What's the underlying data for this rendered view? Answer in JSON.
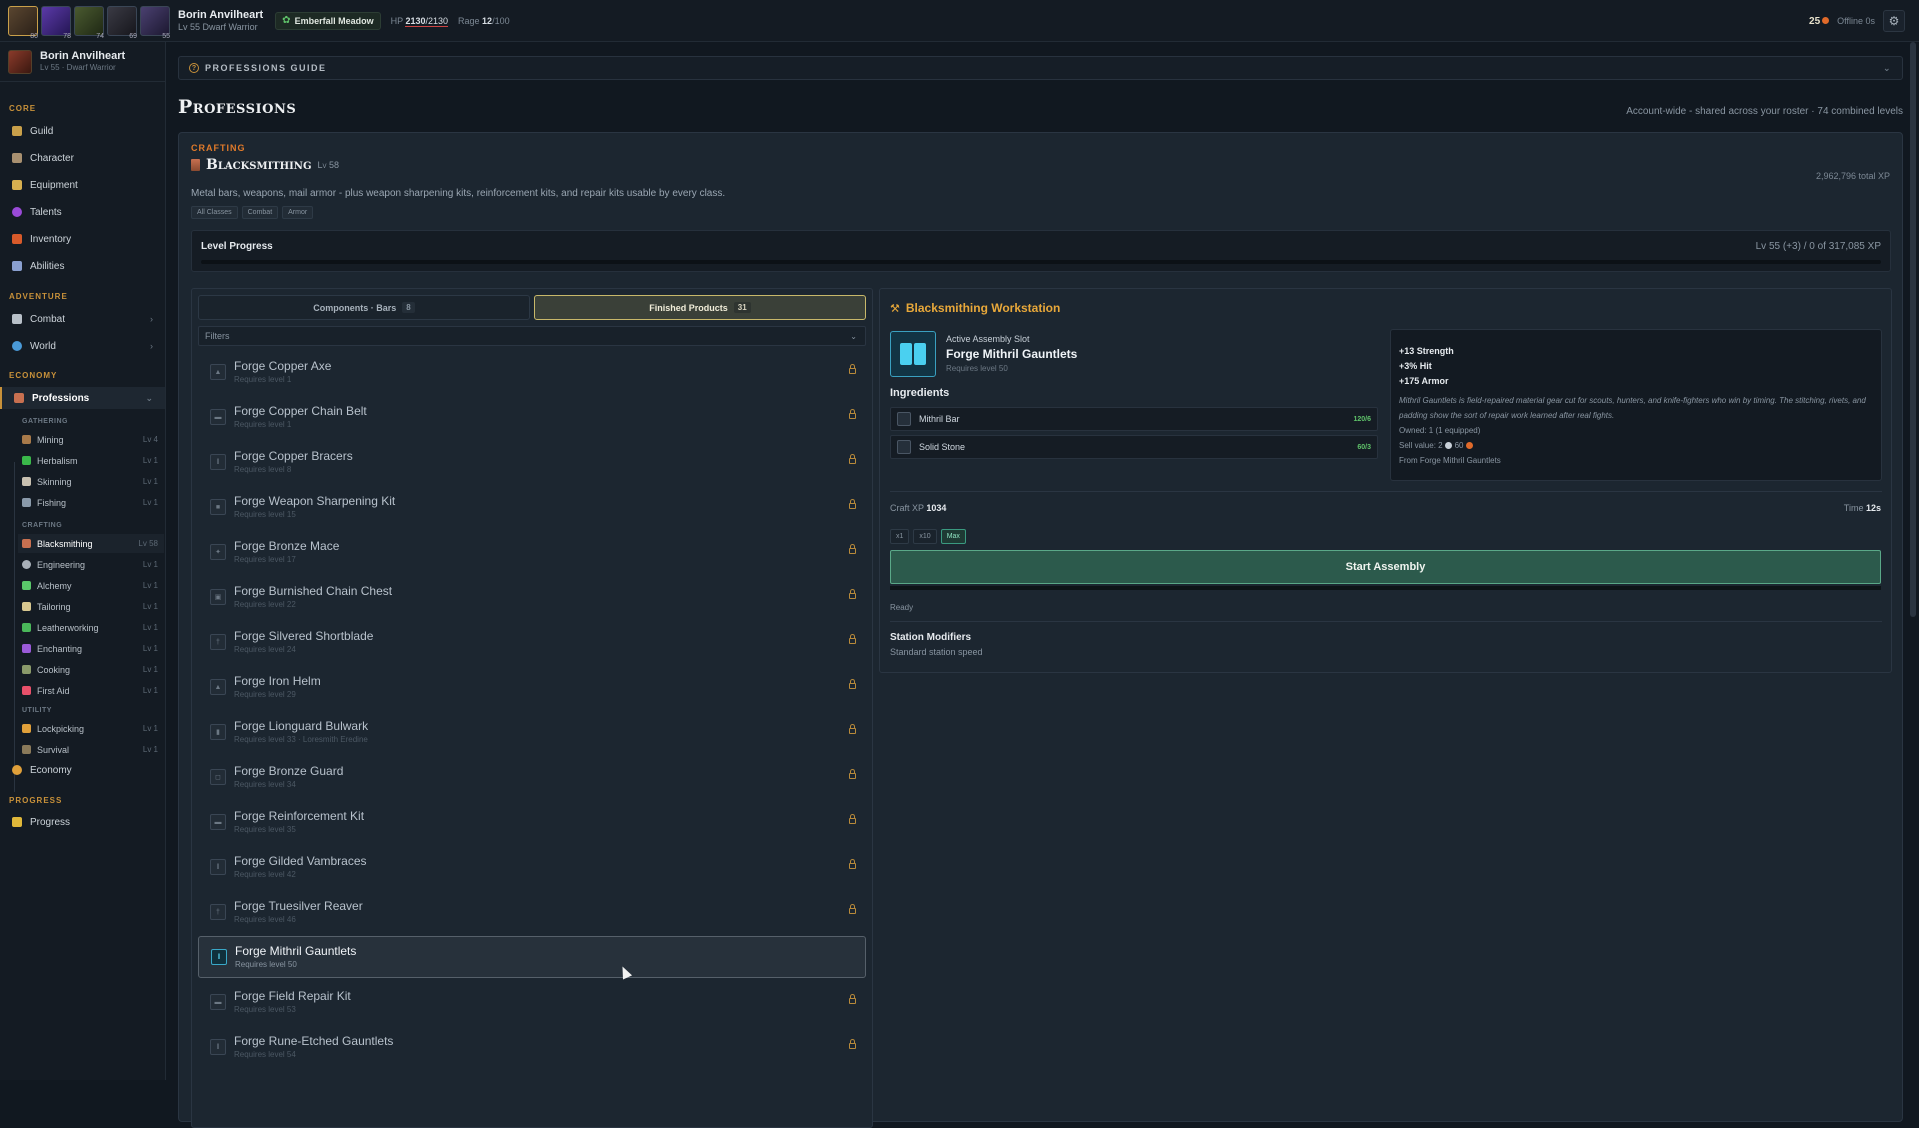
{
  "topbar": {
    "portraits": [
      {
        "name": "warrior-portrait",
        "level": "80"
      },
      {
        "name": "mage-portrait",
        "level": "78"
      },
      {
        "name": "hunter-portrait",
        "level": "74"
      },
      {
        "name": "rogue-portrait",
        "level": "69"
      },
      {
        "name": "priest-portrait",
        "level": "55"
      }
    ],
    "char_name": "Borin Anvilheart",
    "char_sub": "Lv 55 Dwarf Warrior",
    "zone": "Emberfall Meadow",
    "hp_label": "HP",
    "hp_value": "2130",
    "hp_max": "/2130",
    "rage_label": "Rage",
    "rage_value": "12",
    "rage_max": "/100",
    "gold": "25",
    "offline": "Offline 0s"
  },
  "sidebar": {
    "user_name": "Borin Anvilheart",
    "user_sub": "Lv 55 · Dwarf Warrior",
    "sections": {
      "core": "CORE",
      "adventure": "ADVENTURE",
      "economy": "ECONOMY",
      "progress": "PROGRESS"
    },
    "core": [
      "Guild",
      "Character",
      "Equipment",
      "Talents",
      "Inventory",
      "Abilities"
    ],
    "adventure": [
      "Combat",
      "World"
    ],
    "professions_label": "Professions",
    "sub_sections": {
      "gathering": "GATHERING",
      "crafting": "CRAFTING",
      "utility": "UTILITY"
    },
    "gathering": [
      {
        "label": "Mining",
        "lvl": "Lv 4"
      },
      {
        "label": "Herbalism",
        "lvl": "Lv 1"
      },
      {
        "label": "Skinning",
        "lvl": "Lv 1"
      },
      {
        "label": "Fishing",
        "lvl": "Lv 1"
      }
    ],
    "crafting": [
      {
        "label": "Blacksmithing",
        "lvl": "Lv 58"
      },
      {
        "label": "Engineering",
        "lvl": "Lv 1"
      },
      {
        "label": "Alchemy",
        "lvl": "Lv 1"
      },
      {
        "label": "Tailoring",
        "lvl": "Lv 1"
      },
      {
        "label": "Leatherworking",
        "lvl": "Lv 1"
      },
      {
        "label": "Enchanting",
        "lvl": "Lv 1"
      },
      {
        "label": "Cooking",
        "lvl": "Lv 1"
      },
      {
        "label": "First Aid",
        "lvl": "Lv 1"
      }
    ],
    "utility": [
      {
        "label": "Lockpicking",
        "lvl": "Lv 1"
      },
      {
        "label": "Survival",
        "lvl": "Lv 1"
      }
    ],
    "economy_label": "Economy",
    "progress_label": "Progress"
  },
  "main": {
    "guide": "PROFESSIONS GUIDE",
    "title": "Professions",
    "subtitle": "Account-wide - shared across your roster · 74 combined levels",
    "category": "CRAFTING",
    "prof_name": "Blacksmithing",
    "prof_lv": "Lv 58",
    "total_xp": "2,962,796 total XP",
    "desc": "Metal bars, weapons, mail armor - plus weapon sharpening kits, reinforcement kits, and repair kits usable by every class.",
    "tags": [
      "All Classes",
      "Combat",
      "Armor"
    ],
    "level_progress_label": "Level Progress",
    "level_progress_value": "Lv 55 (+3) / 0 of 317,085 XP",
    "level_progress_fraction": 0
  },
  "recipes": {
    "tabs": [
      {
        "label": "Components · Bars",
        "count": "8"
      },
      {
        "label": "Finished Products",
        "count": "31"
      }
    ],
    "filters": "Filters",
    "items": [
      {
        "name": "Forge Copper Axe",
        "req": "Requires level 1"
      },
      {
        "name": "Forge Copper Chain Belt",
        "req": "Requires level 1"
      },
      {
        "name": "Forge Copper Bracers",
        "req": "Requires level 8"
      },
      {
        "name": "Forge Weapon Sharpening Kit",
        "req": "Requires level 15"
      },
      {
        "name": "Forge Bronze Mace",
        "req": "Requires level 17"
      },
      {
        "name": "Forge Burnished Chain Chest",
        "req": "Requires level 22"
      },
      {
        "name": "Forge Silvered Shortblade",
        "req": "Requires level 24"
      },
      {
        "name": "Forge Iron Helm",
        "req": "Requires level 29"
      },
      {
        "name": "Forge Lionguard Bulwark",
        "req": "Requires level 33 · Loresmith Eredine"
      },
      {
        "name": "Forge Bronze Guard",
        "req": "Requires level 34"
      },
      {
        "name": "Forge Reinforcement Kit",
        "req": "Requires level 35"
      },
      {
        "name": "Forge Gilded Vambraces",
        "req": "Requires level 42"
      },
      {
        "name": "Forge Truesilver Reaver",
        "req": "Requires level 46"
      },
      {
        "name": "Forge Mithril Gauntlets",
        "req": "Requires level 50"
      },
      {
        "name": "Forge Field Repair Kit",
        "req": "Requires level 53"
      },
      {
        "name": "Forge Rune-Etched Gauntlets",
        "req": "Requires level 54"
      }
    ]
  },
  "workstation": {
    "title": "Blacksmithing Workstation",
    "slot_label": "Active Assembly Slot",
    "slot_name": "Forge Mithril Gauntlets",
    "slot_req": "Requires level 50",
    "ingredients_label": "Ingredients",
    "ingredients": [
      {
        "name": "Mithril Bar",
        "qty": "120/6"
      },
      {
        "name": "Solid Stone",
        "qty": "60/3"
      }
    ],
    "stats": [
      "+13 Strength",
      "+3% Hit",
      "+175 Armor"
    ],
    "flavor": "Mithril Gauntlets is field-repaired material gear cut for scouts, hunters, and knife-fighters who win by timing. The stitching, rivets, and padding show the sort of repair work learned after real fights.",
    "owned": "Owned: 1 (1 equipped)",
    "sell_label": "Sell value: 2",
    "sell_copper": "60",
    "source": "From Forge Mithril Gauntlets",
    "craft_xp_label": "Craft XP",
    "craft_xp": "1034",
    "time_label": "Time",
    "time": "12s",
    "qty": [
      "x1",
      "x10",
      "Max"
    ],
    "start": "Start Assembly",
    "status": "Ready",
    "mod_title": "Station Modifiers",
    "mod_value": "Standard station speed"
  }
}
